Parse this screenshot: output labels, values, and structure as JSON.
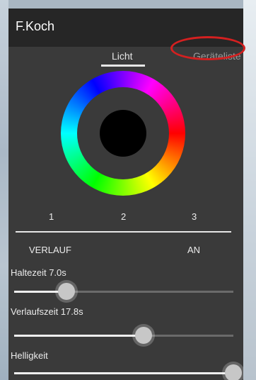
{
  "app": {
    "title": "F.Koch"
  },
  "tabs": [
    {
      "label": "Licht",
      "selected": true
    },
    {
      "label": "Geräteliste",
      "selected": false
    }
  ],
  "color_wheel": {
    "selected_color": "#000000"
  },
  "presets": [
    "1",
    "2",
    "3"
  ],
  "mode": {
    "label": "VERLAUF",
    "state": "AN"
  },
  "sliders": [
    {
      "label": "Haltezeit 7.0s",
      "value": 0.24
    },
    {
      "label": "Verlaufszeit 17.8s",
      "value": 0.59
    },
    {
      "label": "Helligkeit",
      "value": 1.0
    }
  ],
  "colors": {
    "appbar": "#262626",
    "panel": "#3a3a3a",
    "highlight": "#d42020"
  }
}
